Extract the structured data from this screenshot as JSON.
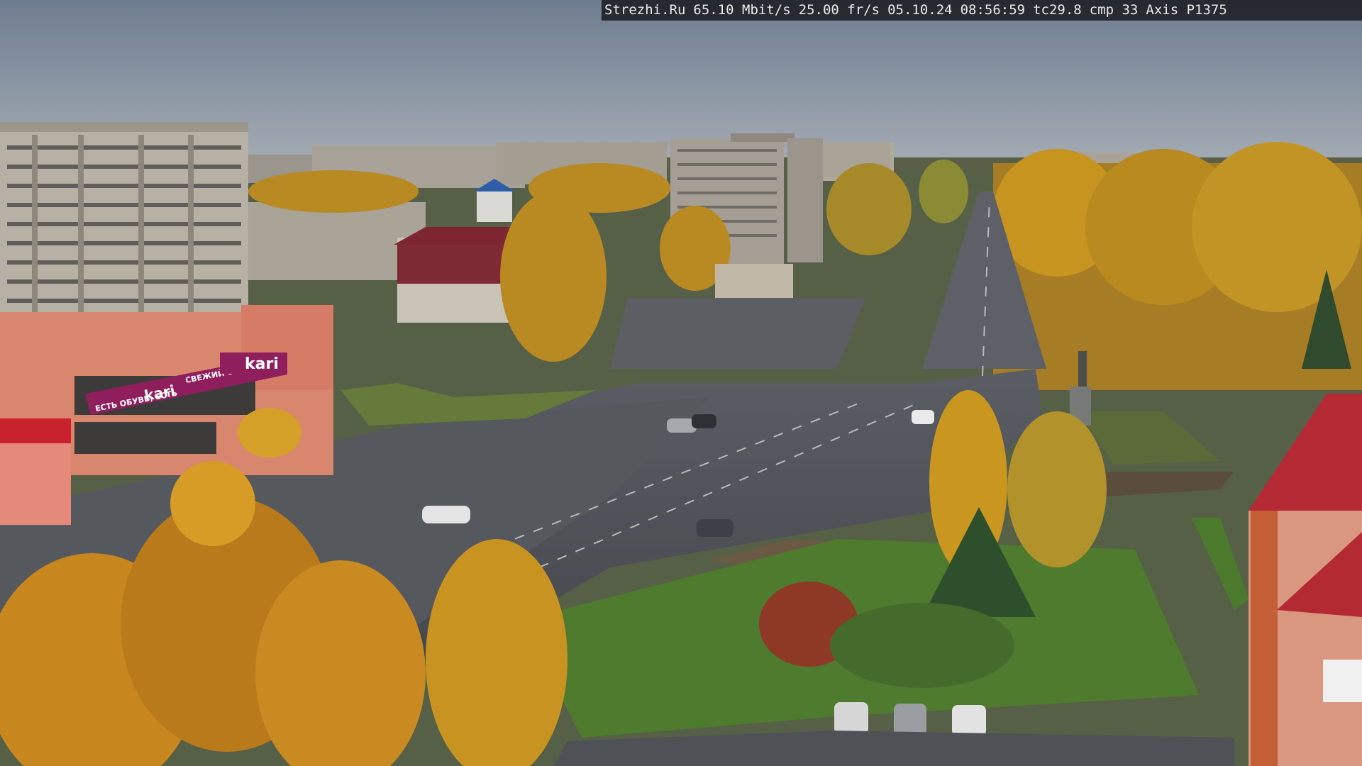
{
  "overlay": {
    "site": "Strezhi.Ru",
    "bitrate": "65.10 Mbit/s",
    "framerate": "25.00 fr/s",
    "date": "05.10.24",
    "time": "08:56:59",
    "tc": "tc29.8",
    "cmp": "cmp 33",
    "camera_model": "Axis P1375"
  },
  "signs": {
    "store_brand": "kari",
    "store_brand_banner": "kari",
    "store_slogan_1": "ЕСТЬ ОБУВЬ, ЕСТЬ",
    "store_slogan_2": "СВЕЖИЙ ОБРАЗ"
  },
  "colors": {
    "sky": "#8f9aa7",
    "asphalt": "#4b4f55",
    "foliage_gold": "#c9901f",
    "kari_banner": "#8e1e5c",
    "store_facade": "#d9866e"
  }
}
